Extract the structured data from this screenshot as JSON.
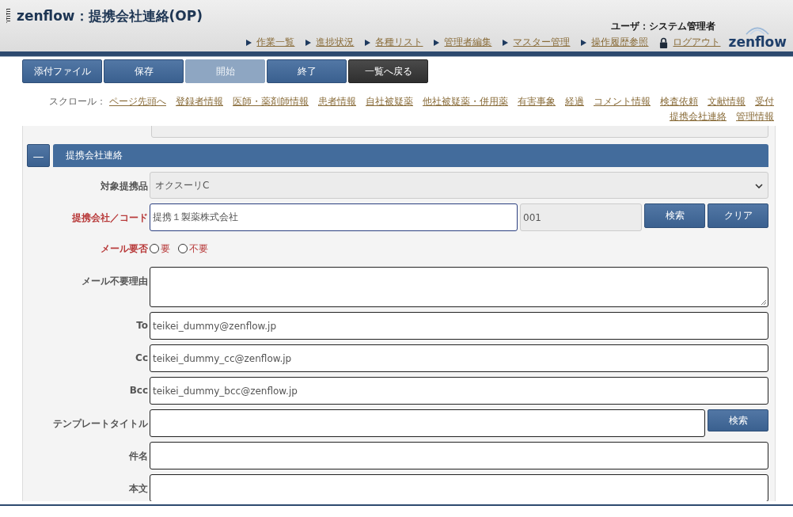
{
  "header": {
    "title": "zenflow：提携会社連絡(OP)",
    "user": "ユーザ：システム管理者",
    "nav": [
      {
        "label": "作業一覧",
        "kind": "arrow"
      },
      {
        "label": "進捗状況",
        "kind": "arrow"
      },
      {
        "label": "各種リスト",
        "kind": "arrow"
      },
      {
        "label": "管理者編集",
        "kind": "arrow"
      },
      {
        "label": "マスター管理",
        "kind": "arrow"
      },
      {
        "label": "操作履歴参照",
        "kind": "arrow"
      },
      {
        "label": "ログアウト",
        "kind": "lock"
      }
    ],
    "logo": "zenflow"
  },
  "toolbar": [
    {
      "label": "添付ファイル",
      "kind": "primary",
      "disabled": false
    },
    {
      "label": "保存",
      "kind": "primary",
      "disabled": false
    },
    {
      "label": "開始",
      "kind": "primary",
      "disabled": true
    },
    {
      "label": "終了",
      "kind": "primary",
      "disabled": false
    },
    {
      "label": "一覧へ戻る",
      "kind": "dark",
      "disabled": false
    }
  ],
  "scroll": {
    "label": "スクロール：",
    "links": [
      "ページ先頭へ",
      "登録者情報",
      "医師・薬剤師情報",
      "患者情報",
      "自社被疑薬",
      "他社被疑薬・併用薬",
      "有害事象",
      "経過",
      "コメント情報",
      "検査依頼",
      "文献情報",
      "受付",
      "提携会社連絡",
      "管理情報"
    ]
  },
  "section": {
    "toggle": "—",
    "title": "提携会社連絡",
    "fields": [
      {
        "kind": "select",
        "label": "対象提携品",
        "required": false,
        "value": "オクスーリC"
      },
      {
        "kind": "lookup",
        "label": "提携会社／コード",
        "required": true,
        "value": "提携１製薬株式会社",
        "code": "001",
        "buttons": [
          "検索",
          "クリア"
        ]
      },
      {
        "kind": "radio",
        "label": "メール要否",
        "required": true,
        "options": [
          {
            "label": "要",
            "selected": false
          },
          {
            "label": "不要",
            "selected": false
          }
        ]
      },
      {
        "kind": "textarea",
        "label": "メール不要理由",
        "required": false
      },
      {
        "kind": "text",
        "label": "To",
        "required": false,
        "value": "teikei_dummy@zenflow.jp"
      },
      {
        "kind": "text",
        "label": "Cc",
        "required": false,
        "value": "teikei_dummy_cc@zenflow.jp"
      },
      {
        "kind": "text",
        "label": "Bcc",
        "required": false,
        "value": "teikei_dummy_bcc@zenflow.jp"
      },
      {
        "kind": "textbutton",
        "label": "テンプレートタイトル",
        "required": false,
        "buttons": [
          "検索"
        ]
      },
      {
        "kind": "text",
        "label": "件名",
        "required": false
      },
      {
        "kind": "text",
        "label": "本文",
        "required": false
      }
    ]
  }
}
